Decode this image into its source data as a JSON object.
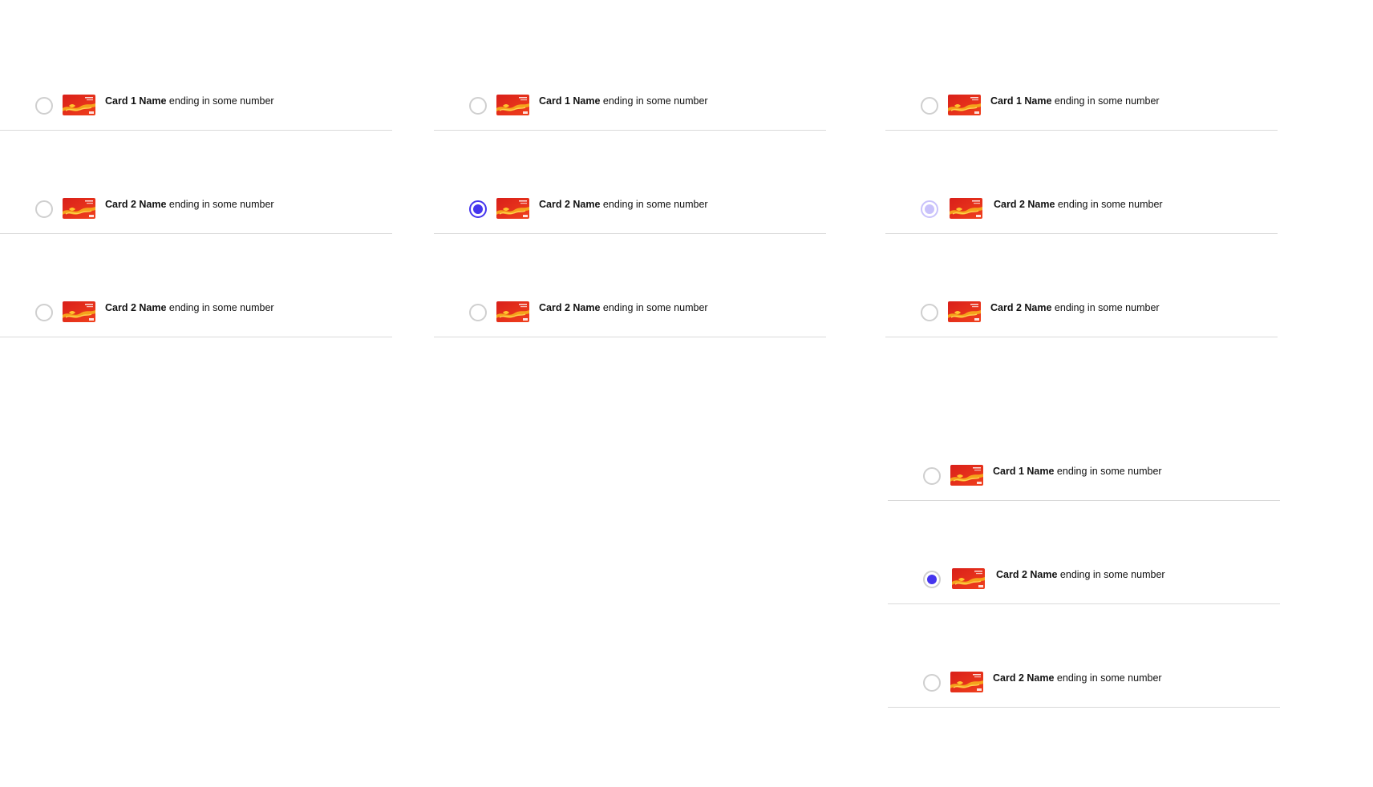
{
  "accent_color": "#4535ee",
  "hover_color": "#c9c2fb",
  "card_icon": "credit-card-icon",
  "groups": [
    {
      "state": "default",
      "rows": [
        {
          "name": "Card 1 Name",
          "suffix": "ending in some number",
          "selected": false
        },
        {
          "name": "Card 2 Name",
          "suffix": "ending in some number",
          "selected": false
        },
        {
          "name": "Card 2 Name",
          "suffix": "ending in some number",
          "selected": false
        }
      ]
    },
    {
      "state": "selected",
      "rows": [
        {
          "name": "Card 1 Name",
          "suffix": "ending in some number",
          "selected": false
        },
        {
          "name": "Card 2 Name",
          "suffix": "ending in some number",
          "selected": true
        },
        {
          "name": "Card 2 Name",
          "suffix": "ending in some number",
          "selected": false
        }
      ]
    },
    {
      "state": "hover",
      "rows": [
        {
          "name": "Card 1 Name",
          "suffix": "ending in some number",
          "selected": false
        },
        {
          "name": "Card 2 Name",
          "suffix": "ending in some number",
          "selected": false,
          "hover": true
        },
        {
          "name": "Card 2 Name",
          "suffix": "ending in some number",
          "selected": false
        }
      ]
    },
    {
      "state": "pressed",
      "rows": [
        {
          "name": "Card 1 Name",
          "suffix": "ending in some number",
          "selected": false
        },
        {
          "name": "Card 2 Name",
          "suffix": "ending in some number",
          "selected": true
        },
        {
          "name": "Card 2 Name",
          "suffix": "ending in some number",
          "selected": false
        }
      ]
    }
  ]
}
